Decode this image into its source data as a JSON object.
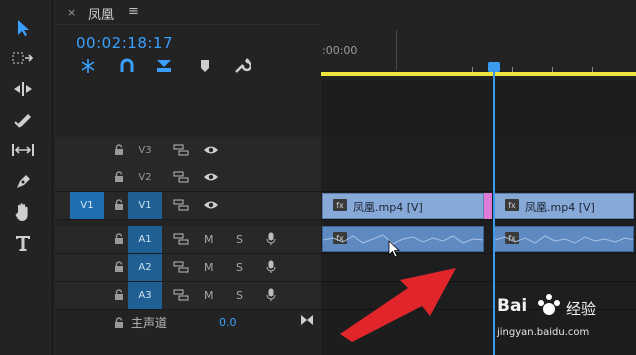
{
  "panel": {
    "close_glyph": "×",
    "title": "凤凰",
    "menu_glyph": "≡"
  },
  "timecode": "00:02:18:17",
  "ruler": {
    "label": ":00:00"
  },
  "tracks": {
    "video": [
      {
        "label": "V3"
      },
      {
        "label": "V2"
      },
      {
        "label": "V1",
        "source_patch": "V1"
      }
    ],
    "audio": [
      {
        "label": "A1",
        "m": "M",
        "s": "S"
      },
      {
        "label": "A2",
        "m": "M",
        "s": "S"
      },
      {
        "label": "A3",
        "m": "M",
        "s": "S"
      }
    ]
  },
  "clips": {
    "video_left_label": "凤凰.mp4 [V]",
    "video_right_label": "凤凰.mp4 [V]",
    "fx": "fx"
  },
  "master": {
    "label": "主声道",
    "value": "0.0"
  },
  "watermark": {
    "brand": "Bai",
    "brand_cn": "经验",
    "url": "jingyan.baidu.com"
  },
  "colors": {
    "accent": "#3aa0ff",
    "ruler_bar": "#f0e53c",
    "clip_video": "#86a9d8",
    "clip_audio": "#5f8ac1",
    "arrow": "#e0262b"
  },
  "icons": {
    "tools": [
      "selection-tool-icon",
      "track-select-icon",
      "ripple-edit-icon",
      "razor-icon",
      "slip-icon",
      "pen-icon",
      "hand-icon",
      "type-icon"
    ],
    "header": [
      "snap-icon",
      "linked-selection-icon",
      "insert-overwrite-icon",
      "marker-icon",
      "settings-wrench-icon"
    ]
  }
}
